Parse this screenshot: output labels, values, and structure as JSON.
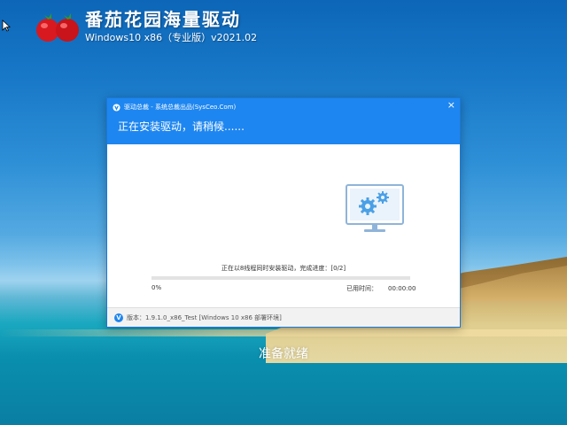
{
  "brand": {
    "title": "番茄花园海量驱动",
    "subtitle": "Windows10 x86（专业版）v2021.02"
  },
  "dialog": {
    "title": "驱动总裁 - 系统总裁出品(SysCeo.Com)",
    "close_label": "×",
    "heading": "正在安装驱动，请稍候......",
    "status": "正在以8线程同时安装驱动，完成进度：[0/2]",
    "progress_label": "0%",
    "progress_value": 0,
    "elapsed_label": "已用时间：",
    "elapsed_time": "00:00:00",
    "footer_badge": "V",
    "version": "版本：1.9.1.0_x86_Test [Windows 10 x86 部署环境]"
  },
  "ready_text": "准备就绪",
  "colors": {
    "accent": "#1e86f0",
    "progress_track": "#e3e3e3"
  },
  "icons": {
    "logo": "tomato-logo-icon",
    "app": "driver-app-icon",
    "monitor": "monitor-gears-icon",
    "cursor": "mouse-cursor-icon"
  }
}
